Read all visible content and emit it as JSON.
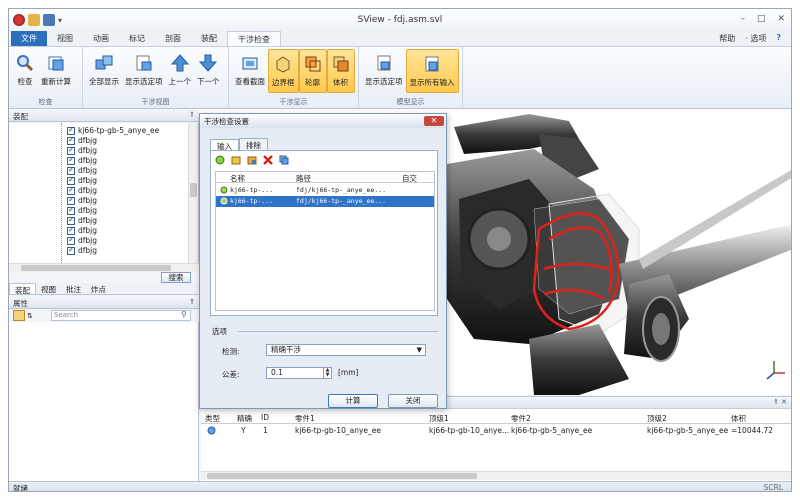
{
  "window": {
    "title": "SView - fdj.asm.svl",
    "controls": [
      "–",
      "□",
      "✕"
    ]
  },
  "tabs": {
    "file": "文件",
    "items": [
      "视图",
      "动画",
      "标记",
      "剖面",
      "装配"
    ],
    "active": "干涉检查",
    "help": "帮助",
    "options": "· 选项",
    "help_icon": "?"
  },
  "ribbon": {
    "groups": [
      {
        "name": "检查",
        "buttons": [
          "检查",
          "重新计算"
        ]
      },
      {
        "name": "干涉视图",
        "buttons": [
          "全部显示",
          "显示选定项",
          "上一个",
          "下一个"
        ]
      },
      {
        "name": "干涉显示",
        "buttons": [
          "查看截面",
          "边界框",
          "轮廓",
          "体积"
        ]
      },
      {
        "name": "模型显示",
        "buttons": [
          "显示选定项",
          "显示所有输入"
        ]
      }
    ]
  },
  "assembly": {
    "title": "装配",
    "items": [
      "kj66-tp-gb-5_anye_ee",
      "dfbjg",
      "dfbjg",
      "dfbjg",
      "dfbjg",
      "dfbjg",
      "dfbjg",
      "dfbjg",
      "dfbjg",
      "dfbjg",
      "dfbjg",
      "dfbjg",
      "dfbjg"
    ],
    "search_button": "搜索",
    "tabs": [
      "装配",
      "视图",
      "批注",
      "炸点"
    ]
  },
  "properties": {
    "title": "属性",
    "search_placeholder": "Search"
  },
  "dialog": {
    "title": "干涉检查设置",
    "tabs": [
      "输入",
      "排除"
    ],
    "columns": [
      "名称",
      "路径",
      "自交"
    ],
    "rows": [
      {
        "name": "kj66-tp-...",
        "path": "fdj/kj66-tp-_anye_ee..."
      },
      {
        "name": "kj66-tp-...",
        "path": "fdj/kj66-tp-_anye_ee..."
      }
    ],
    "options_label": "选项",
    "check_label": "检测:",
    "check_value": "精确干涉",
    "tolerance_label": "公差:",
    "tolerance_value": "0.1",
    "unit": "[mm]",
    "compute_button": "计算",
    "close_button": "关闭"
  },
  "results": {
    "columns": [
      "类型",
      "精确",
      "ID",
      "零件1",
      "顶级1",
      "零件2",
      "顶级2",
      "体积"
    ],
    "row": [
      "",
      "Y",
      "1",
      "kj66-tp-gb-10_anye_ee",
      "kj66-tp-gb-10_anye...",
      "kj66-tp-gb-5_anye_ee",
      "kj66-tp-gb-5_anye_ee",
      "=10044.72"
    ]
  },
  "status": {
    "left": "就绪",
    "right": "SCRL"
  },
  "colors": {
    "ribbon_active": "#ffc94d",
    "file_tab": "#2c6fbd",
    "selection": "#2f74c9",
    "interference": "#e0201a"
  }
}
